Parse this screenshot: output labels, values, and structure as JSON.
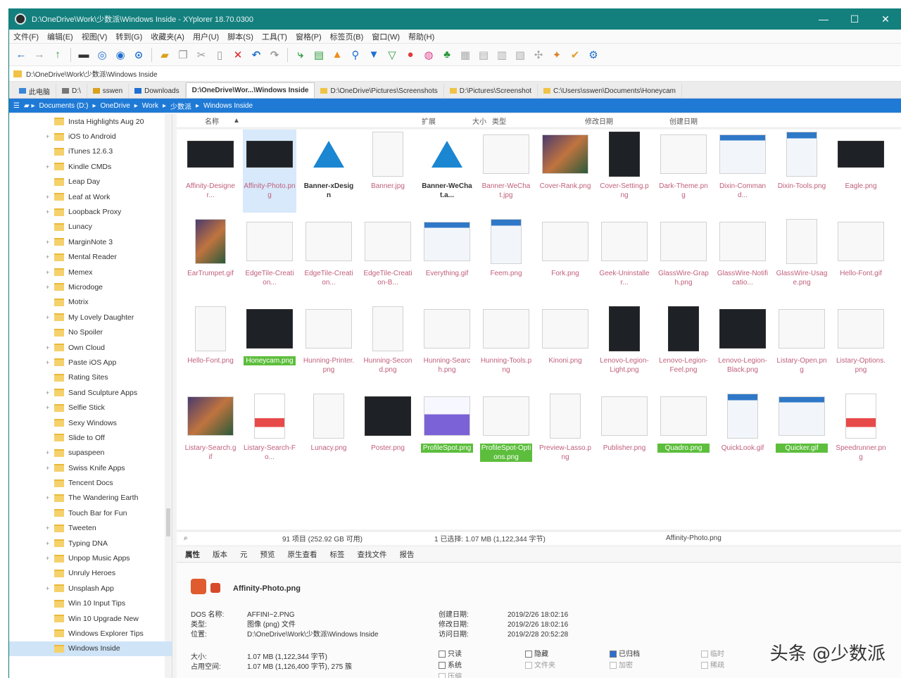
{
  "window": {
    "title": "D:\\OneDrive\\Work\\少数派\\Windows Inside - XYplorer 18.70.0300",
    "minimize": "—",
    "maximize": "☐",
    "close": "✕"
  },
  "menu": [
    "文件(F)",
    "编辑(E)",
    "视图(V)",
    "转到(G)",
    "收藏夹(A)",
    "用户(U)",
    "脚本(S)",
    "工具(T)",
    "窗格(P)",
    "标签页(B)",
    "窗口(W)",
    "帮助(H)"
  ],
  "address": "D:\\OneDrive\\Work\\少数派\\Windows Inside",
  "tabs": [
    {
      "label": "此电脑"
    },
    {
      "label": "D:\\"
    },
    {
      "label": "sswen"
    },
    {
      "label": "Downloads"
    },
    {
      "label": "D:\\OneDrive\\Wor...\\Windows Inside"
    },
    {
      "label": "D:\\OneDrive\\Pictures\\Screenshots"
    },
    {
      "label": "D:\\Pictures\\Screenshot"
    },
    {
      "label": "C:\\Users\\sswen\\Documents\\Honeycam"
    }
  ],
  "breadcrumb": [
    "Documents (D:)",
    "OneDrive",
    "Work",
    "少数派",
    "Windows Inside"
  ],
  "tree": [
    {
      "label": "Insta Highlights Aug 20"
    },
    {
      "label": "iOS to Android"
    },
    {
      "label": "iTunes 12.6.3"
    },
    {
      "label": "Kindle CMDs"
    },
    {
      "label": "Leap Day"
    },
    {
      "label": "Leaf at Work"
    },
    {
      "label": "Loopback Proxy"
    },
    {
      "label": "Lunacy"
    },
    {
      "label": "MarginNote 3"
    },
    {
      "label": "Mental Reader"
    },
    {
      "label": "Memex"
    },
    {
      "label": "Microdoge"
    },
    {
      "label": "Motrix"
    },
    {
      "label": "My Lovely Daughter"
    },
    {
      "label": "No Spoiler"
    },
    {
      "label": "Own Cloud"
    },
    {
      "label": "Paste iOS App"
    },
    {
      "label": "Rating Sites"
    },
    {
      "label": "Sand Sculpture Apps"
    },
    {
      "label": "Selfie Stick"
    },
    {
      "label": "Sexy Windows"
    },
    {
      "label": "Slide to Off"
    },
    {
      "label": "supaspeen"
    },
    {
      "label": "Swiss Knife Apps"
    },
    {
      "label": "Tencent Docs"
    },
    {
      "label": "The Wandering Earth"
    },
    {
      "label": "Touch Bar for Fun"
    },
    {
      "label": "Tweeten"
    },
    {
      "label": "Typing DNA"
    },
    {
      "label": "Unpop Music Apps"
    },
    {
      "label": "Unruly Heroes"
    },
    {
      "label": "Unsplash App"
    },
    {
      "label": "Win 10 Input Tips"
    },
    {
      "label": "Win 10 Upgrade New"
    },
    {
      "label": "Windows Explorer Tips"
    },
    {
      "label": "Windows Inside"
    }
  ],
  "columns": {
    "name": "名称",
    "ext": "扩展",
    "size": "大小",
    "type": "类型",
    "modified": "修改日期",
    "created": "创建日期"
  },
  "files": [
    {
      "label": "Affinity-Designer...",
      "thumb": "dark",
      "style": "pink"
    },
    {
      "label": "Affinity-Photo.png",
      "thumb": "dark",
      "style": "pink"
    },
    {
      "label": "Banner-xDesign",
      "thumb": "triangle",
      "style": "black"
    },
    {
      "label": "Banner.jpg",
      "thumb": "light",
      "style": "pink"
    },
    {
      "label": "Banner-WeChat.a...",
      "thumb": "triangle",
      "style": "black"
    },
    {
      "label": "Banner-WeChat.jpg",
      "thumb": "light",
      "style": "pink"
    },
    {
      "label": "Cover-Rank.png",
      "thumb": "color",
      "style": "pink"
    },
    {
      "label": "Cover-Setting.png",
      "thumb": "dark",
      "style": "pink"
    },
    {
      "label": "Dark-Theme.png",
      "thumb": "light",
      "style": "pink"
    },
    {
      "label": "Dixin-Command...",
      "thumb": "ui",
      "style": "pink"
    },
    {
      "label": "Dixin-Tools.png",
      "thumb": "ui",
      "style": "pink"
    },
    {
      "label": "Eagle.png",
      "thumb": "dark",
      "style": "pink"
    },
    {
      "label": "EarTrumpet.gif",
      "thumb": "color",
      "style": "pink"
    },
    {
      "label": "EdgeTile-Creation...",
      "thumb": "light",
      "style": "pink"
    },
    {
      "label": "EdgeTile-Creation...",
      "thumb": "light",
      "style": "pink"
    },
    {
      "label": "EdgeTile-Creation-B...",
      "thumb": "light",
      "style": "pink"
    },
    {
      "label": "Everything.gif",
      "thumb": "ui",
      "style": "pink"
    },
    {
      "label": "Feem.png",
      "thumb": "ui",
      "style": "pink"
    },
    {
      "label": "Fork.png",
      "thumb": "light",
      "style": "pink"
    },
    {
      "label": "Geek-Uninstaller...",
      "thumb": "light",
      "style": "pink"
    },
    {
      "label": "GlassWire-Graph.png",
      "thumb": "light",
      "style": "pink"
    },
    {
      "label": "GlassWire-Notificatio...",
      "thumb": "light",
      "style": "pink"
    },
    {
      "label": "GlassWire-Usage.png",
      "thumb": "light",
      "style": "pink"
    },
    {
      "label": "Hello-Font.gif",
      "thumb": "light",
      "style": "pink"
    },
    {
      "label": "Hello-Font.png",
      "thumb": "light",
      "style": "pink"
    },
    {
      "label": "Honeycam.png",
      "thumb": "dark",
      "style": "green"
    },
    {
      "label": "Hunning-Printer.png",
      "thumb": "light",
      "style": "pink"
    },
    {
      "label": "Hunning-Second.png",
      "thumb": "light",
      "style": "pink"
    },
    {
      "label": "Hunning-Search.png",
      "thumb": "light",
      "style": "pink"
    },
    {
      "label": "Hunning-Tools.png",
      "thumb": "light",
      "style": "pink"
    },
    {
      "label": "Kinoni.png",
      "thumb": "light",
      "style": "pink"
    },
    {
      "label": "Lenovo-Legion-Light.png",
      "thumb": "dark",
      "style": "pink"
    },
    {
      "label": "Lenovo-Legion-Feel.png",
      "thumb": "dark",
      "style": "pink"
    },
    {
      "label": "Lenovo-Legion-Black.png",
      "thumb": "dark",
      "style": "pink"
    },
    {
      "label": "Listary-Open.png",
      "thumb": "light",
      "style": "pink"
    },
    {
      "label": "Listary-Options.png",
      "thumb": "light",
      "style": "pink"
    },
    {
      "label": "Listary-Search.gif",
      "thumb": "color",
      "style": "pink"
    },
    {
      "label": "Listary-Search-Fo...",
      "thumb": "red",
      "style": "pink"
    },
    {
      "label": "Lunacy.png",
      "thumb": "light",
      "style": "pink"
    },
    {
      "label": "Poster.png",
      "thumb": "dark",
      "style": "pink"
    },
    {
      "label": "ProfileSpot.png",
      "thumb": "chart",
      "style": "green"
    },
    {
      "label": "ProfileSpot-Options.png",
      "thumb": "light",
      "style": "green"
    },
    {
      "label": "Preview-Lasso.png",
      "thumb": "light",
      "style": "pink"
    },
    {
      "label": "Publisher.png",
      "thumb": "light",
      "style": "pink"
    },
    {
      "label": "Quadro.png",
      "thumb": "light",
      "style": "green"
    },
    {
      "label": "QuickLook.gif",
      "thumb": "ui",
      "style": "pink"
    },
    {
      "label": "Quicker.gif",
      "thumb": "ui",
      "style": "green"
    },
    {
      "label": "Speedrunner.png",
      "thumb": "red",
      "style": "pink"
    }
  ],
  "status": {
    "search": "⌕",
    "items": "91 项目 (252.92 GB 可用)",
    "selection": "1 已选择: 1.07 MB (1,122,344 字节)",
    "current": "Affinity-Photo.png"
  },
  "info_tabs": [
    "属性",
    "版本",
    "元",
    "预览",
    "原生查看",
    "标签",
    "查找文件",
    "报告"
  ],
  "info": {
    "file_name": "Affinity-Photo.png",
    "dos_name_label": "DOS 名称:",
    "dos_name": "AFFINI~2.PNG",
    "type_label": "类型:",
    "type": "图像 (png) 文件",
    "location_label": "位置:",
    "location": "D:\\OneDrive\\Work\\少数派\\Windows Inside",
    "size_label": "大小:",
    "size": "1.07 MB (1,122,344 字节)",
    "size_on_disk_label": "占用空间:",
    "size_on_disk": "1.07 MB (1,126,400 字节), 275 簇",
    "created_label": "创建日期:",
    "created": "2019/2/26 18:02:16",
    "modified_label": "修改日期:",
    "modified": "2019/2/26 18:02:16",
    "accessed_label": "访问日期:",
    "accessed": "2019/2/28 20:52:28",
    "attrs": [
      "只读",
      "隐藏",
      "已归档",
      "系统",
      "文件夹",
      "加密",
      "临时",
      "稀疏",
      "压缩"
    ]
  },
  "watermark": "头条 @少数派"
}
